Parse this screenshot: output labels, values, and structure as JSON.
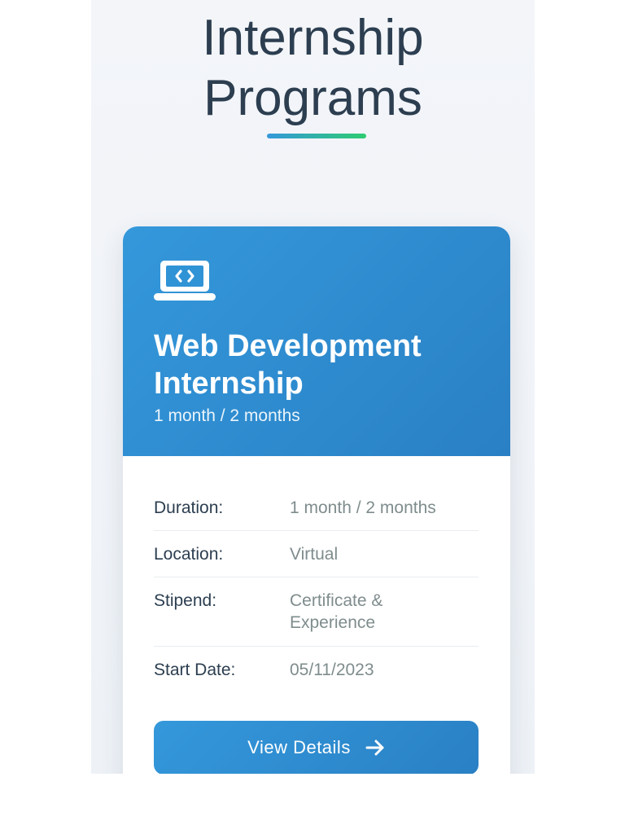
{
  "page": {
    "title_line1": "Internship",
    "title_line2": "Programs"
  },
  "card": {
    "icon": "laptop-code-icon",
    "title_line1": "Web Development",
    "title_line2": "Internship",
    "subtitle": "1 month / 2 months",
    "details": [
      {
        "label": "Duration:",
        "value": "1 month / 2 months"
      },
      {
        "label": "Location:",
        "value": "Virtual"
      },
      {
        "label": "Stipend:",
        "value_line1": "Certificate &",
        "value_line2": "Experience"
      },
      {
        "label": "Start Date:",
        "value": "05/11/2023"
      }
    ],
    "button_label": "View Details",
    "button_icon": "arrow-right-icon"
  },
  "colors": {
    "primary": "#3498db",
    "primary_dark": "#2a80c4",
    "accent_green": "#2ecc71",
    "heading": "#2c3e50",
    "muted": "#7f8c8d",
    "page_bg": "#f3f5f9"
  }
}
